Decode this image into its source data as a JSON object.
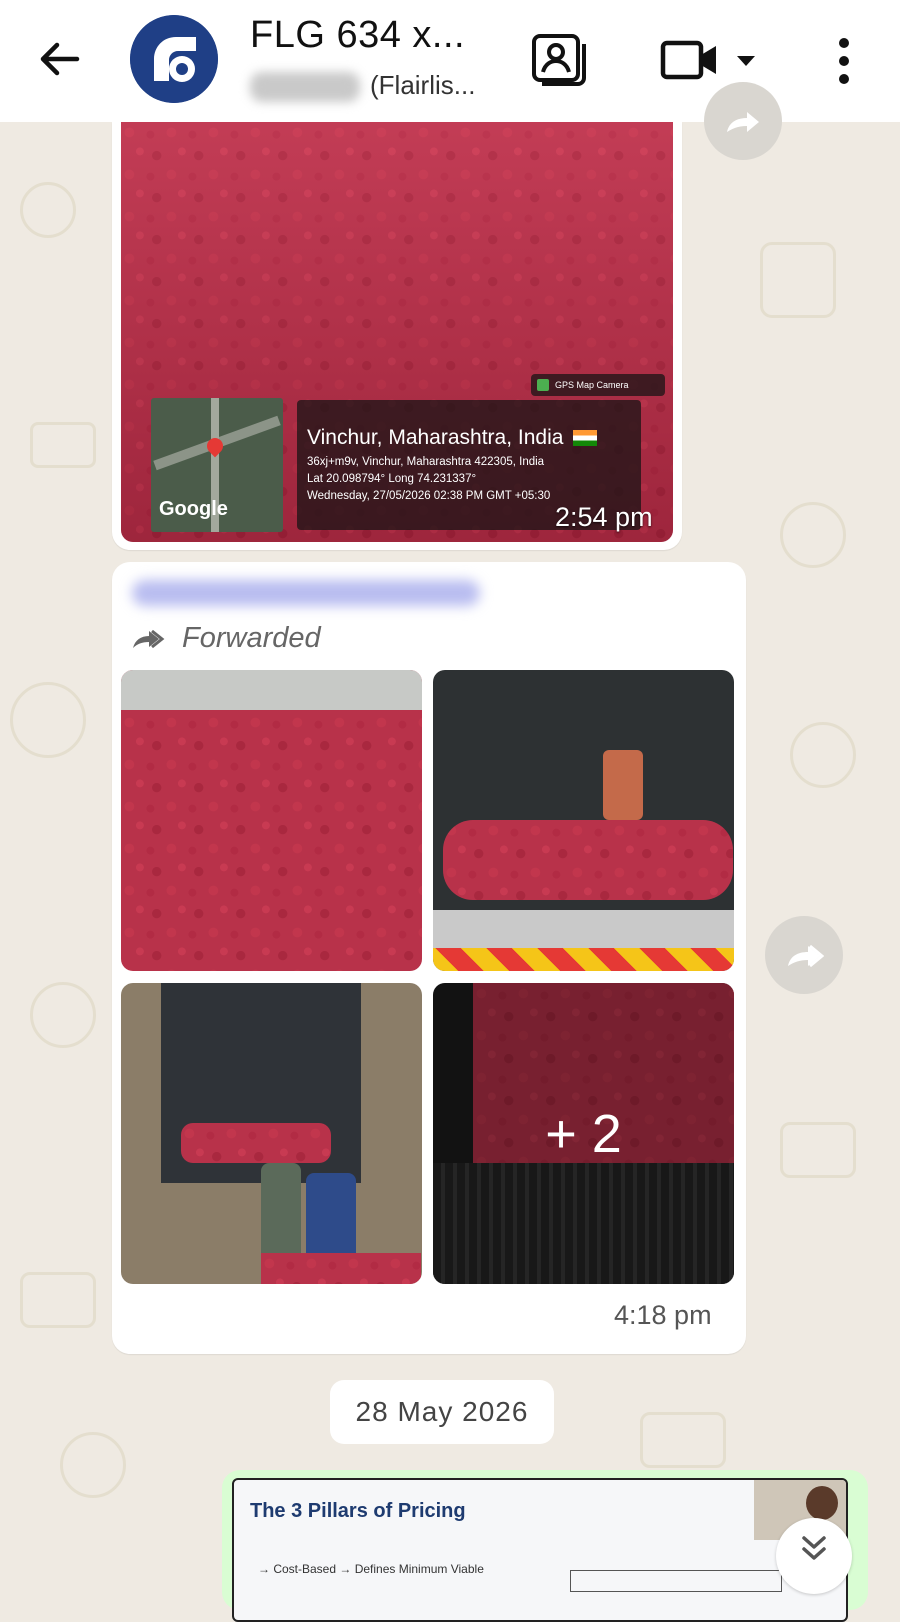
{
  "header": {
    "title": "FLG 634 x...",
    "subtitle": "(Flairlis...",
    "icons": [
      "back-arrow-icon",
      "contact-card-icon",
      "video-call-icon",
      "chevron-down-icon",
      "more-vertical-icon"
    ]
  },
  "messages": [
    {
      "type": "image",
      "gps_overlay": {
        "app": "GPS Map Camera",
        "location": "Vinchur, Maharashtra, India",
        "address": "36xj+m9v, Vinchur, Maharashtra 422305, India",
        "coords": "Lat 20.098794° Long 74.231337°",
        "datetime": "Wednesday, 27/05/2026 02:38 PM GMT +05:30",
        "map_brand": "Google"
      },
      "time": "2:54 pm"
    },
    {
      "type": "forwarded_album",
      "forwarded_label": "Forwarded",
      "more_count": "+ 2",
      "time": "4:18 pm"
    }
  ],
  "date_divider": "28 May 2026",
  "outgoing_preview": {
    "doc_title": "The 3 Pillars of Pricing",
    "doc_line": "→ Cost-Based → Defines Minimum Viable"
  }
}
